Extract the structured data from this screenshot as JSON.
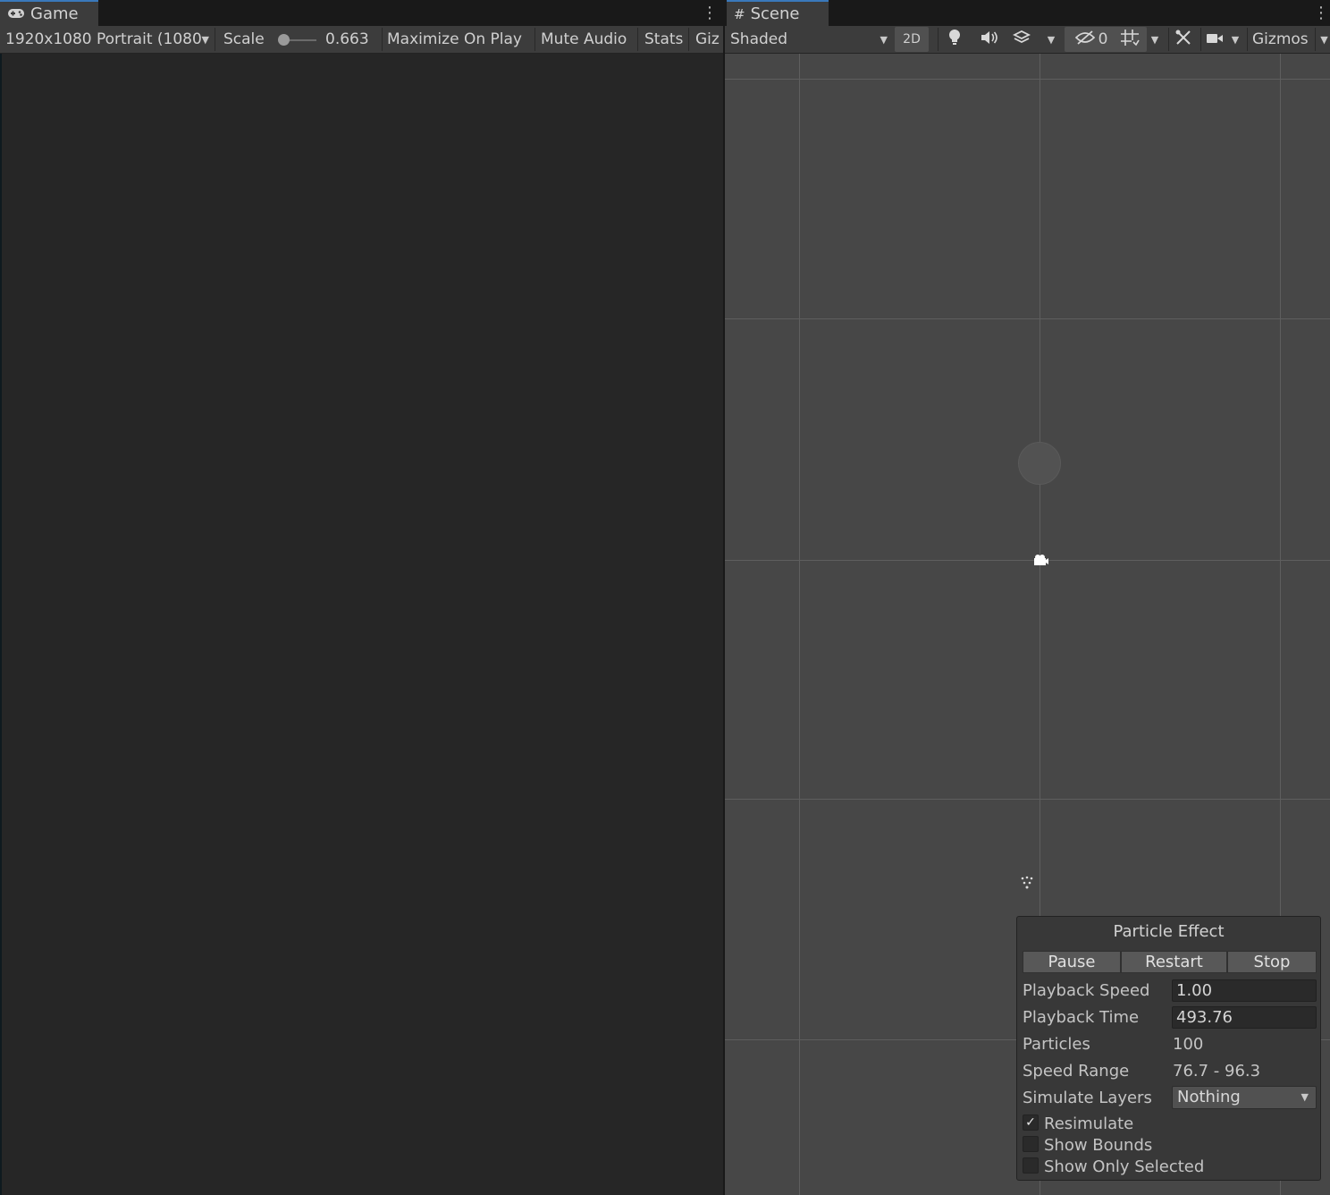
{
  "game": {
    "tab_label": "Game",
    "toolbar": {
      "resolution": "1920x1080 Portrait (1080",
      "scale_label": "Scale",
      "scale_value": "0.663",
      "maximize_on_play": "Maximize On Play",
      "mute_audio": "Mute Audio",
      "stats": "Stats",
      "gizmos_truncated": "Giz"
    }
  },
  "scene": {
    "tab_label": "Scene",
    "toolbar": {
      "draw_mode": "Shaded",
      "mode_2d": "2D",
      "hidden_count": "0",
      "gizmos": "Gizmos"
    }
  },
  "particle_effect": {
    "title": "Particle Effect",
    "buttons": {
      "pause": "Pause",
      "restart": "Restart",
      "stop": "Stop"
    },
    "playback_speed": {
      "label": "Playback Speed",
      "value": "1.00"
    },
    "playback_time": {
      "label": "Playback Time",
      "value": "493.76"
    },
    "particles": {
      "label": "Particles",
      "value": "100"
    },
    "speed_range": {
      "label": "Speed Range",
      "value": "76.7 - 96.3"
    },
    "simulate_layers": {
      "label": "Simulate Layers",
      "value": "Nothing"
    },
    "resimulate": {
      "label": "Resimulate",
      "checked": true
    },
    "show_bounds": {
      "label": "Show Bounds",
      "checked": false
    },
    "show_only_selected": {
      "label": "Show Only Selected",
      "checked": false
    }
  },
  "colors": {
    "accent": "#3a79bb",
    "panel": "#3c3c3c",
    "scene_bg": "#474747",
    "game_bg": "#262626"
  }
}
